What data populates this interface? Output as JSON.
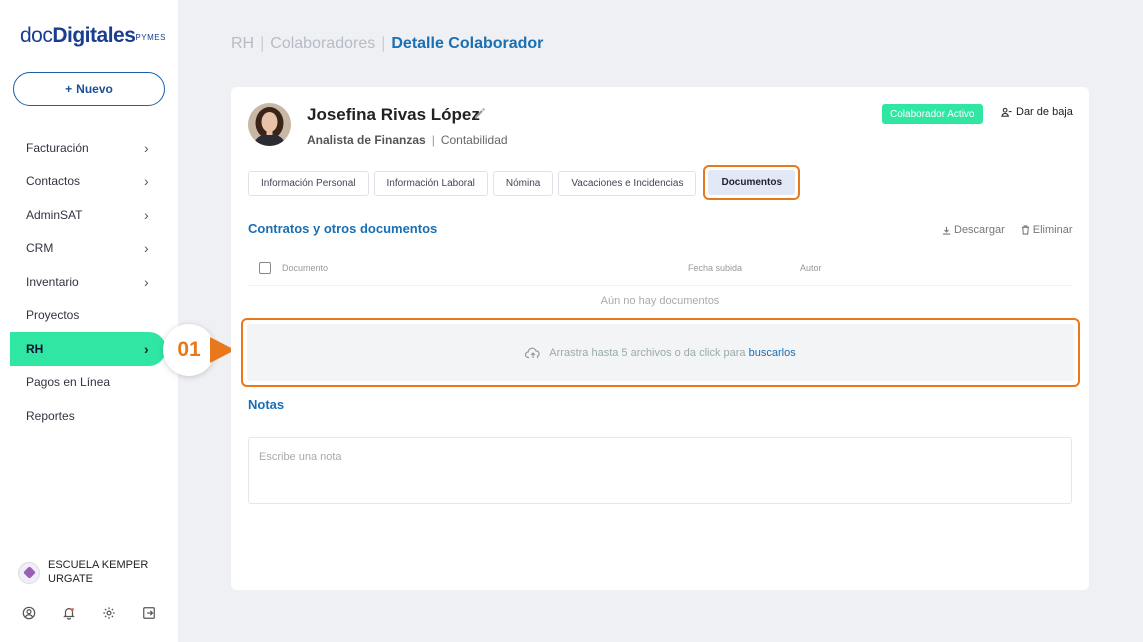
{
  "brand": {
    "part1": "doc",
    "part2": "Digitales",
    "part3": "PYMES"
  },
  "sidebar": {
    "new_label": "Nuevo",
    "items": [
      {
        "label": "Facturación",
        "has_chevron": true
      },
      {
        "label": "Contactos",
        "has_chevron": true
      },
      {
        "label": "AdminSAT",
        "has_chevron": true
      },
      {
        "label": "CRM",
        "has_chevron": true
      },
      {
        "label": "Inventario",
        "has_chevron": true
      },
      {
        "label": "Proyectos",
        "has_chevron": false
      },
      {
        "label": "RH",
        "has_chevron": true,
        "active": true
      },
      {
        "label": "Pagos en Línea",
        "has_chevron": false
      },
      {
        "label": "Reportes",
        "has_chevron": false
      }
    ],
    "org_name": "ESCUELA KEMPER URGATE",
    "bottom_icons": [
      "user-icon",
      "bell-icon",
      "gear-icon",
      "logout-icon"
    ]
  },
  "annotation": {
    "step": "01",
    "color": "#e9781a"
  },
  "breadcrumb": {
    "level1": "RH",
    "level2": "Colaboradores",
    "current": "Detalle Colaborador"
  },
  "employee": {
    "name": "Josefina Rivas López",
    "role": "Analista de Finanzas",
    "department": "Contabilidad",
    "status": "Colaborador Activo",
    "deactivate_label": "Dar de baja"
  },
  "tabs": [
    {
      "label": "Información Personal"
    },
    {
      "label": "Información Laboral"
    },
    {
      "label": "Nómina"
    },
    {
      "label": "Vacaciones e Incidencias"
    },
    {
      "label": "Documentos",
      "active": true
    }
  ],
  "documents": {
    "title": "Contratos y otros documentos",
    "download_label": "Descargar",
    "delete_label": "Eliminar",
    "columns": {
      "document": "Documento",
      "uploaded": "Fecha subida",
      "author": "Autor"
    },
    "empty_text": "Aún no hay documentos",
    "dropzone_text": "Arrastra hasta 5 archivos o da click para",
    "dropzone_link": "buscarlos"
  },
  "notes": {
    "title": "Notas",
    "placeholder": "Escribe una nota"
  },
  "colors": {
    "accent": "#2fe6a3",
    "primary": "#1a6fb3",
    "highlight": "#e9781a"
  }
}
